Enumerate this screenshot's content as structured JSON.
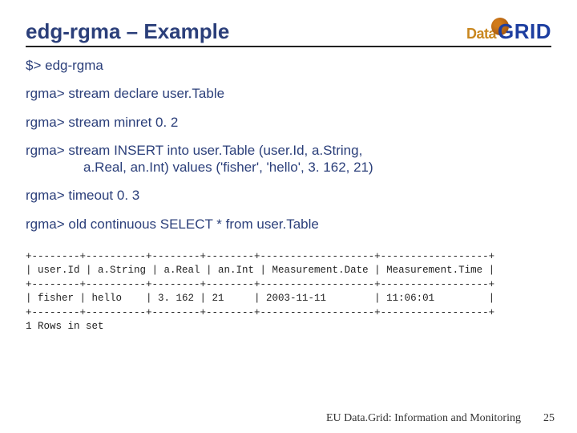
{
  "header": {
    "title": "edg-rgma – Example",
    "logo_data": "Data",
    "logo_grid": "GRID"
  },
  "lines": {
    "l0_prompt": "$> ",
    "l0_cmd": "edg-rgma",
    "l1_prompt": "rgma> ",
    "l1_cmd": "stream declare user.Table",
    "l2_prompt": "rgma> ",
    "l2_cmd": "stream minret 0. 2",
    "l3_prompt": "rgma> ",
    "l3_cmd_a": "stream INSERT into user.Table (user.Id, a.String,",
    "l3_cmd_b": "a.Real, an.Int)  values ('fisher', 'hello', 3. 162, 21)",
    "l4_prompt": "rgma> ",
    "l4_cmd": "timeout 0. 3",
    "l5_prompt": "rgma> ",
    "l5_cmd": "old continuous SELECT * from user.Table"
  },
  "table": {
    "sep": "+--------+----------+--------+--------+-------------------+------------------+",
    "hdr": "| user.Id | a.String | a.Real | an.Int | Measurement.Date | Measurement.Time |",
    "row": "| fisher | hello    | 3. 162 | 21     | 2003-11-11        | 11:06:01         |",
    "footer": "1 Rows in set"
  },
  "footer": {
    "text": "EU Data.Grid: Information and Monitoring",
    "page": "25"
  }
}
